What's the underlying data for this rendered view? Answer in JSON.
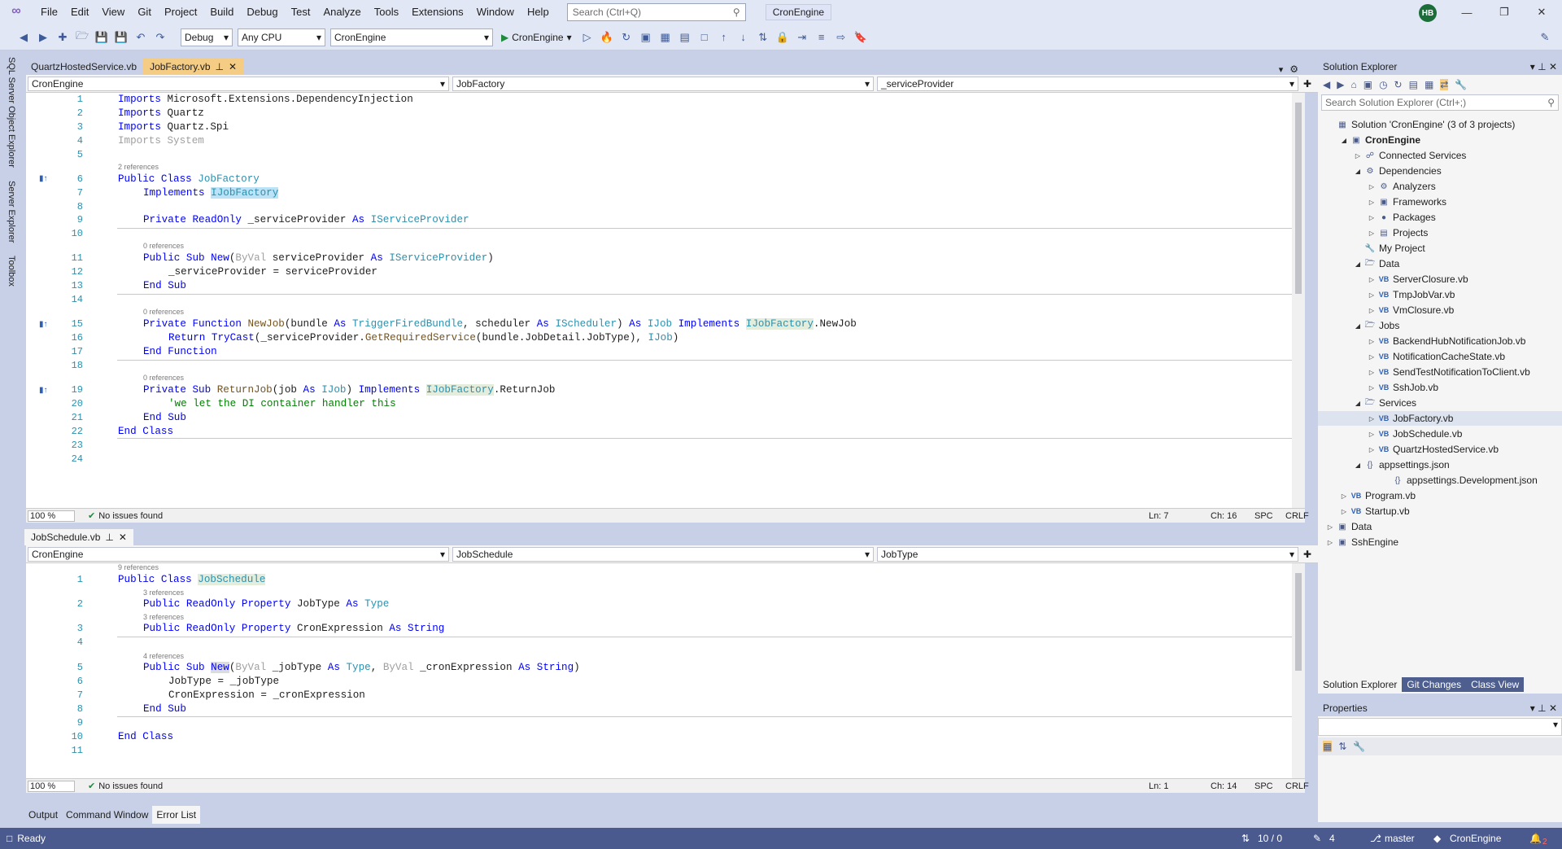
{
  "menu": {
    "items": [
      "File",
      "Edit",
      "View",
      "Git",
      "Project",
      "Build",
      "Debug",
      "Test",
      "Analyze",
      "Tools",
      "Extensions",
      "Window",
      "Help"
    ],
    "search_placeholder": "Search (Ctrl+Q)",
    "solution_name": "CronEngine",
    "user_initials": "HB"
  },
  "toolbar": {
    "config": "Debug",
    "platform": "Any CPU",
    "project": "CronEngine",
    "run_label": "CronEngine"
  },
  "left_tabs": [
    "SQL Server Object Explorer",
    "Server Explorer",
    "Toolbox"
  ],
  "editor_top": {
    "tabs": [
      {
        "label": "QuartzHostedService.vb"
      },
      {
        "label": "JobFactory.vb"
      }
    ],
    "nav": {
      "project": "CronEngine",
      "class": "JobFactory",
      "member": "_serviceProvider"
    },
    "refs": [
      "2 references",
      "0 references",
      "0 references",
      "0 references"
    ],
    "lines": [
      "1",
      "2",
      "3",
      "4",
      "5",
      "6",
      "7",
      "8",
      "9",
      "10",
      "11",
      "12",
      "13",
      "14",
      "15",
      "16",
      "17",
      "18",
      "19",
      "20",
      "21",
      "22",
      "23",
      "24"
    ],
    "status": {
      "zoom": "100 %",
      "issues": "No issues found",
      "ln": "Ln: 7",
      "ch": "Ch: 16",
      "spc": "SPC",
      "crlf": "CRLF"
    }
  },
  "editor_bottom": {
    "tab": "JobSchedule.vb",
    "nav": {
      "project": "CronEngine",
      "class": "JobSchedule",
      "member": "JobType"
    },
    "refs": [
      "9 references",
      "3 references",
      "3 references",
      "4 references"
    ],
    "lines": [
      "1",
      "2",
      "3",
      "4",
      "5",
      "6",
      "7",
      "8",
      "9",
      "10",
      "11"
    ],
    "status": {
      "zoom": "100 %",
      "issues": "No issues found",
      "ln": "Ln: 1",
      "ch": "Ch: 14",
      "spc": "SPC",
      "crlf": "CRLF"
    }
  },
  "code": {
    "t_imports": "Imports",
    "t_ns1": " Microsoft.Extensions.DependencyInjection",
    "t_ns2": " Quartz",
    "t_ns3": " Quartz.Spi",
    "t_ns4": " System",
    "t_public": "Public",
    "t_class": " Class ",
    "t_jobfactory": "JobFactory",
    "t_implements": "Implements",
    "t_ijobfactory": "IJobFactory",
    "t_private_readonly": "Private ReadOnly",
    "t_sp_field": " _serviceProvider ",
    "t_as": "As",
    "t_iserviceprovider": "IServiceProvider",
    "t_public_sub": "Public Sub",
    "t_new": "New",
    "t_byval": "ByVal",
    "t_sp_param": " serviceProvider ",
    "t_assign": "_serviceProvider = serviceProvider",
    "t_end_sub": "End Sub",
    "t_private_function": "Private Function",
    "t_newjob": "NewJob",
    "t_bundle": "(bundle ",
    "t_trigger": "TriggerFiredBundle",
    "t_scheduler": ", scheduler ",
    "t_ischeduler": "IScheduler",
    "t_ijob": "IJob",
    "t_dot_newjob": ".NewJob",
    "t_return": "Return",
    "t_trycast": "TryCast",
    "t_getreq": "(_serviceProvider.",
    "t_getreqfn": "GetRequiredService",
    "t_getreq2": "(bundle.JobDetail.JobType), ",
    "t_end_function": "End Function",
    "t_private_sub": "Private Sub",
    "t_returnjob": "ReturnJob",
    "t_job": "(job ",
    "t_dot_returnjob": ".ReturnJob",
    "t_comment": "'we let the DI container handler this",
    "t_end_class": "End Class",
    "b_jobschedule": "JobSchedule",
    "b_public_readonly_property": "Public ReadOnly Property",
    "b_jobtype": " JobType ",
    "b_type": "Type",
    "b_cronexpr": " CronExpression ",
    "b_string": "String",
    "b_jobtype_param": " _jobType ",
    "b_cron_param": " _cronExpression ",
    "b_assign1": "JobType = _jobType",
    "b_assign2": "CronExpression = _cronExpression"
  },
  "solution_explorer": {
    "title": "Solution Explorer",
    "search_placeholder": "Search Solution Explorer (Ctrl+;)",
    "items": [
      {
        "label": "Solution 'CronEngine' (3 of 3 projects)"
      },
      {
        "label": "CronEngine"
      },
      {
        "label": "Connected Services"
      },
      {
        "label": "Dependencies"
      },
      {
        "label": "Analyzers"
      },
      {
        "label": "Frameworks"
      },
      {
        "label": "Packages"
      },
      {
        "label": "Projects"
      },
      {
        "label": "My Project"
      },
      {
        "label": "Data"
      },
      {
        "label": "ServerClosure.vb"
      },
      {
        "label": "TmpJobVar.vb"
      },
      {
        "label": "VmClosure.vb"
      },
      {
        "label": "Jobs"
      },
      {
        "label": "BackendHubNotificationJob.vb"
      },
      {
        "label": "NotificationCacheState.vb"
      },
      {
        "label": "SendTestNotificationToClient.vb"
      },
      {
        "label": "SshJob.vb"
      },
      {
        "label": "Services"
      },
      {
        "label": "JobFactory.vb"
      },
      {
        "label": "JobSchedule.vb"
      },
      {
        "label": "QuartzHostedService.vb"
      },
      {
        "label": "appsettings.json"
      },
      {
        "label": "appsettings.Development.json"
      },
      {
        "label": "Program.vb"
      },
      {
        "label": "Startup.vb"
      },
      {
        "label": "Data"
      },
      {
        "label": "SshEngine"
      }
    ],
    "tabs": [
      "Solution Explorer",
      "Git Changes",
      "Class View"
    ]
  },
  "properties": {
    "title": "Properties"
  },
  "output_tabs": [
    "Output",
    "Command Window",
    "Error List"
  ],
  "status": {
    "ready": "Ready",
    "lines": "10 / 0",
    "pencil": "4",
    "branch": "master",
    "repo": "CronEngine",
    "notifications": "2"
  },
  "colors": {
    "accent": "#4a5a8f",
    "active_tab": "#f5cc84",
    "keyword": "#0000ff",
    "type": "#2b91af"
  }
}
